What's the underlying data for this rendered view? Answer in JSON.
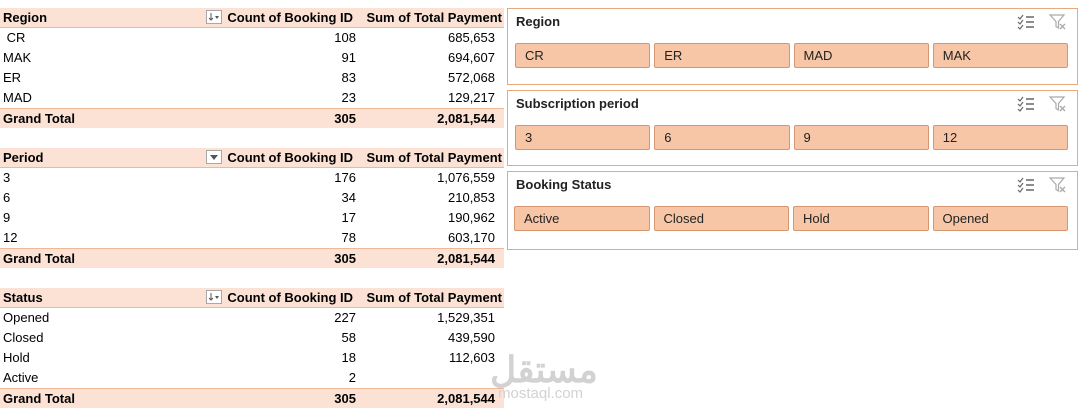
{
  "pivot_region": {
    "header": [
      "Region",
      "Count of Booking ID",
      "Sum of Total Payment"
    ],
    "rows": [
      [
        " CR",
        "108",
        "685,653"
      ],
      [
        "MAK",
        "91",
        "694,607"
      ],
      [
        "ER",
        "83",
        "572,068"
      ],
      [
        "MAD",
        "23",
        "129,217"
      ]
    ],
    "total": [
      "Grand Total",
      "305",
      "2,081,544"
    ]
  },
  "pivot_period": {
    "header": [
      "Period",
      "Count of Booking ID",
      "Sum of Total Payment"
    ],
    "rows": [
      [
        "3",
        "176",
        "1,076,559"
      ],
      [
        "6",
        "34",
        "210,853"
      ],
      [
        "9",
        "17",
        "190,962"
      ],
      [
        "12",
        "78",
        "603,170"
      ]
    ],
    "total": [
      "Grand Total",
      "305",
      "2,081,544"
    ]
  },
  "pivot_status": {
    "header": [
      "Status",
      "Count of Booking ID",
      "Sum of Total Payment"
    ],
    "rows": [
      [
        "Opened",
        "227",
        "1,529,351"
      ],
      [
        "Closed",
        "58",
        "439,590"
      ],
      [
        "Hold",
        "18",
        "112,603"
      ],
      [
        "Active",
        "2",
        ""
      ]
    ],
    "total": [
      "Grand Total",
      "305",
      "2,081,544"
    ]
  },
  "slicers": [
    {
      "title": "Region",
      "items": [
        "CR",
        "ER",
        "MAD",
        "MAK"
      ]
    },
    {
      "title": "Subscription period",
      "items": [
        "3",
        "6",
        "9",
        "12"
      ]
    },
    {
      "title": "Booking Status",
      "items": [
        "Active",
        "Closed",
        "Hold",
        "Opened"
      ]
    }
  ],
  "watermark": {
    "arabic": "مستقل",
    "latin": "mostaql.com"
  },
  "colors": {
    "header_fill": "#fbe2d5",
    "slicer_border": "#e9a97c",
    "slicer_button": "#f7c6a6"
  },
  "icons": {
    "sort_dropdown": "sort-filter-dropdown-icon",
    "multi_select": "multi-select-icon",
    "clear_filter": "clear-filter-icon"
  }
}
